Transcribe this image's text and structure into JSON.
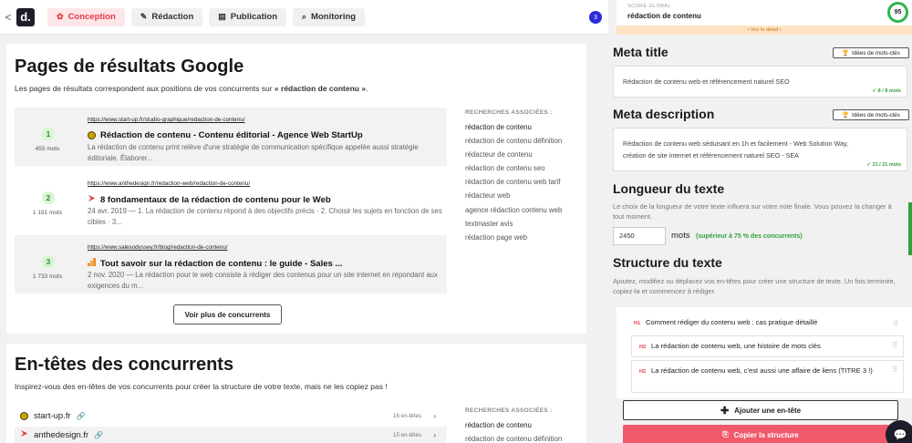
{
  "nav": {
    "back": "<",
    "logo": "d.",
    "tabs": [
      {
        "label": "Conception",
        "icon": "✿"
      },
      {
        "label": "Rédaction",
        "icon": "✎"
      },
      {
        "label": "Publication",
        "icon": "▤"
      },
      {
        "label": "Monitoring",
        "icon": "⌕"
      }
    ],
    "notification_count": "3"
  },
  "results": {
    "title": "Pages de résultats Google",
    "subtitle_pre": "Les pages de résultats correspondent aux positions de vos concurrents sur ",
    "subtitle_kw": "« rédaction de contenu »",
    "subtitle_post": ".",
    "items": [
      {
        "rank": "1",
        "words": "455 mots",
        "url": "https://www.start-up.fr/studio-graphique/redaction-de-contenu/",
        "title": "Rédaction de contenu - Contenu éditorial - Agence Web StartUp",
        "desc": "La rédaction de contenu print relève d'une stratégie de communication spécifique appelée aussi stratégie éditoriale. Élaborer...",
        "favicon_color": "#c9a400"
      },
      {
        "rank": "2",
        "words": "1 191 mots",
        "url": "https://www.anthedesign.fr/redaction-web/redaction-de-contenu/",
        "title": "8 fondamentaux de la rédaction de contenu pour le Web",
        "desc": "24 avr. 2019 — 1. La rédaction de contenu répond à des objectifs précis · 2. Choisir les sujets en fonction de ses cibles · 3...",
        "favicon_color": "#e5394a"
      },
      {
        "rank": "3",
        "words": "1 733 mots",
        "url": "https://www.salesodyssey.fr/blog/redaction-de-contenu/",
        "title": "Tout savoir sur la rédaction de contenu : le guide - Sales ...",
        "desc": "2 nov. 2020 — La rédaction pour le web consiste à rédiger des contenus pour un site internet en répondant aux exigences du m...",
        "favicon_color": "#f08a24"
      }
    ],
    "more_button": "Voir plus de concurrents"
  },
  "associated": {
    "heading": "RECHERCHES ASSOCIÉES :",
    "items": [
      "rédaction de contenu",
      "rédaction de contenu définition",
      "rédacteur de contenu",
      "rédaction de contenu seo",
      "rédaction de contenu web tarif",
      "rédacteur web",
      "agence rédaction contenu web",
      "textmaster avis",
      "rédaction page web"
    ]
  },
  "headings_section": {
    "title": "En-têtes des concurrents",
    "subtitle": "Inspirez-vous des en-têtes de vos concurrents pour créer la structure de votre texte, mais ne les copiez pas !",
    "competitors": [
      {
        "name": "start-up.fr",
        "count": "16 en-têtes",
        "favicon_color": "#c9a400"
      },
      {
        "name": "anthedesign.fr",
        "count": "15 en-têtes",
        "favicon_color": "#e5394a"
      }
    ],
    "assoc_heading": "RECHERCHES ASSOCIÉES :",
    "assoc_first": "rédaction de contenu",
    "assoc_second": "rédaction de contenu définition"
  },
  "score": {
    "label": "SCORE GLOBAL",
    "keyword": "rédaction de contenu",
    "value": "95",
    "detail_link": "• Voir le détail •"
  },
  "meta_title": {
    "title": "Meta title",
    "ideas_button": "Idées de mots-clés",
    "value": "Rédaction de contenu web et référencement naturel SEO",
    "count": "✓ 8 / 8 mots"
  },
  "meta_description": {
    "title": "Meta description",
    "ideas_button": "Idées de mots-clés",
    "line1": "Rédaction de contenu web séduisant en 1h et facilement - Web Solution Way,",
    "line2": "création de site internet et référencement naturel SEO - SEA",
    "count": "✓ 21 / 21 mots"
  },
  "length": {
    "title": "Longueur du texte",
    "desc": "Le choix de la longueur de votre texte influera sur votre note finale. Vous pouvez la changer à tout moment.",
    "value": "2450",
    "unit": "mots",
    "note": "(supérieur à 75 % des concurrents)"
  },
  "structure": {
    "title": "Structure du texte",
    "desc": "Ajoutez, modifiez ou déplacez vos en-têtes pour créer une structure de texte. Un fois terminée, copiez-la et commencez à rédiger.",
    "headings": [
      {
        "tag": "H1",
        "text": "Comment rédiger du contenu web : cas pratique détaillé"
      },
      {
        "tag": "H2",
        "text": "La rédaction de contenu web, une histoire de mots clés"
      },
      {
        "tag": "H2",
        "text": "La rédaction de contenu web, c'est aussi une affaire de liens (TITRE 3 !)"
      }
    ],
    "add_button": "Ajouter une en-tête",
    "copy_button": "Copier la structure"
  }
}
